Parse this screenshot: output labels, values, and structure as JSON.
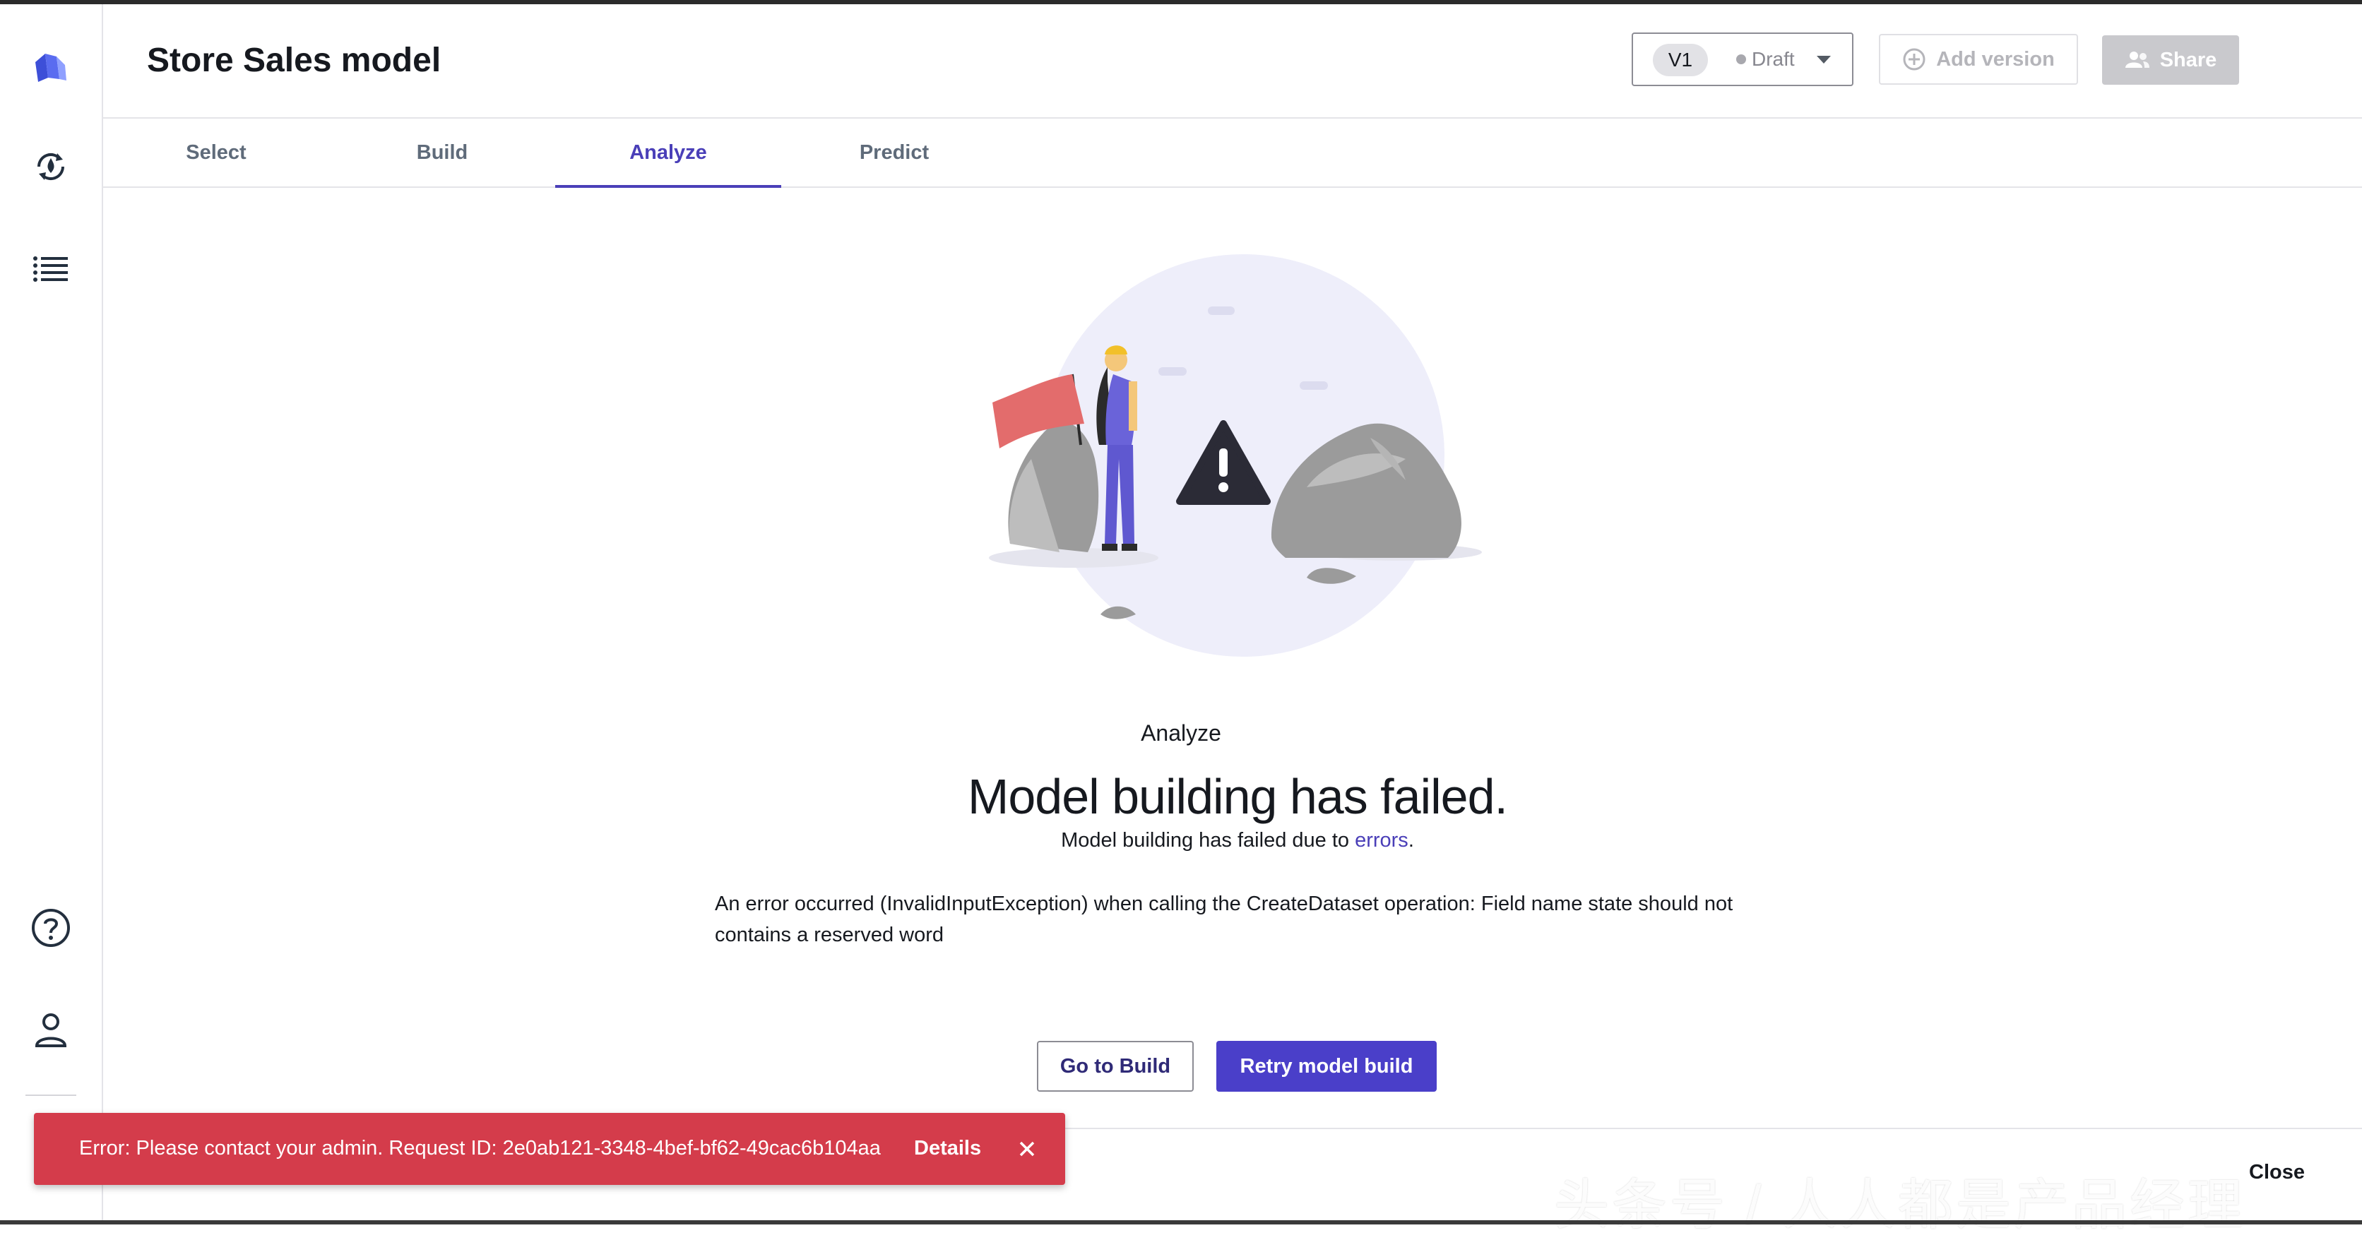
{
  "header": {
    "title": "Store Sales model",
    "version_label": "V1",
    "status_label": "Draft",
    "add_version_label": "Add version",
    "share_label": "Share"
  },
  "sidebar": {
    "icons": [
      "logo-icon",
      "model-icon",
      "list-icon",
      "help-icon",
      "user-icon"
    ]
  },
  "tabs": [
    {
      "label": "Select",
      "active": false
    },
    {
      "label": "Build",
      "active": false
    },
    {
      "label": "Analyze",
      "active": true
    },
    {
      "label": "Predict",
      "active": false
    }
  ],
  "main": {
    "section_label": "Analyze",
    "headline": "Model building has failed.",
    "subtext_prefix": "Model building has failed due to ",
    "subtext_link": "errors",
    "subtext_suffix": ".",
    "error_message": "An error occurred (InvalidInputException) when calling the CreateDataset operation: Field name state should not contains a reserved word",
    "go_to_build_label": "Go to Build",
    "retry_label": "Retry model build",
    "close_label": "Close"
  },
  "toast": {
    "message": "Error: Please contact your admin. Request ID: 2e0ab121-3348-4bef-bf62-49cac6b104aa",
    "details_label": "Details"
  },
  "watermark": "头条号 / 人人都是产品经理",
  "colors": {
    "accent": "#4a3fc9",
    "error": "#d43c4b",
    "disabled": "#c9c9cd"
  }
}
